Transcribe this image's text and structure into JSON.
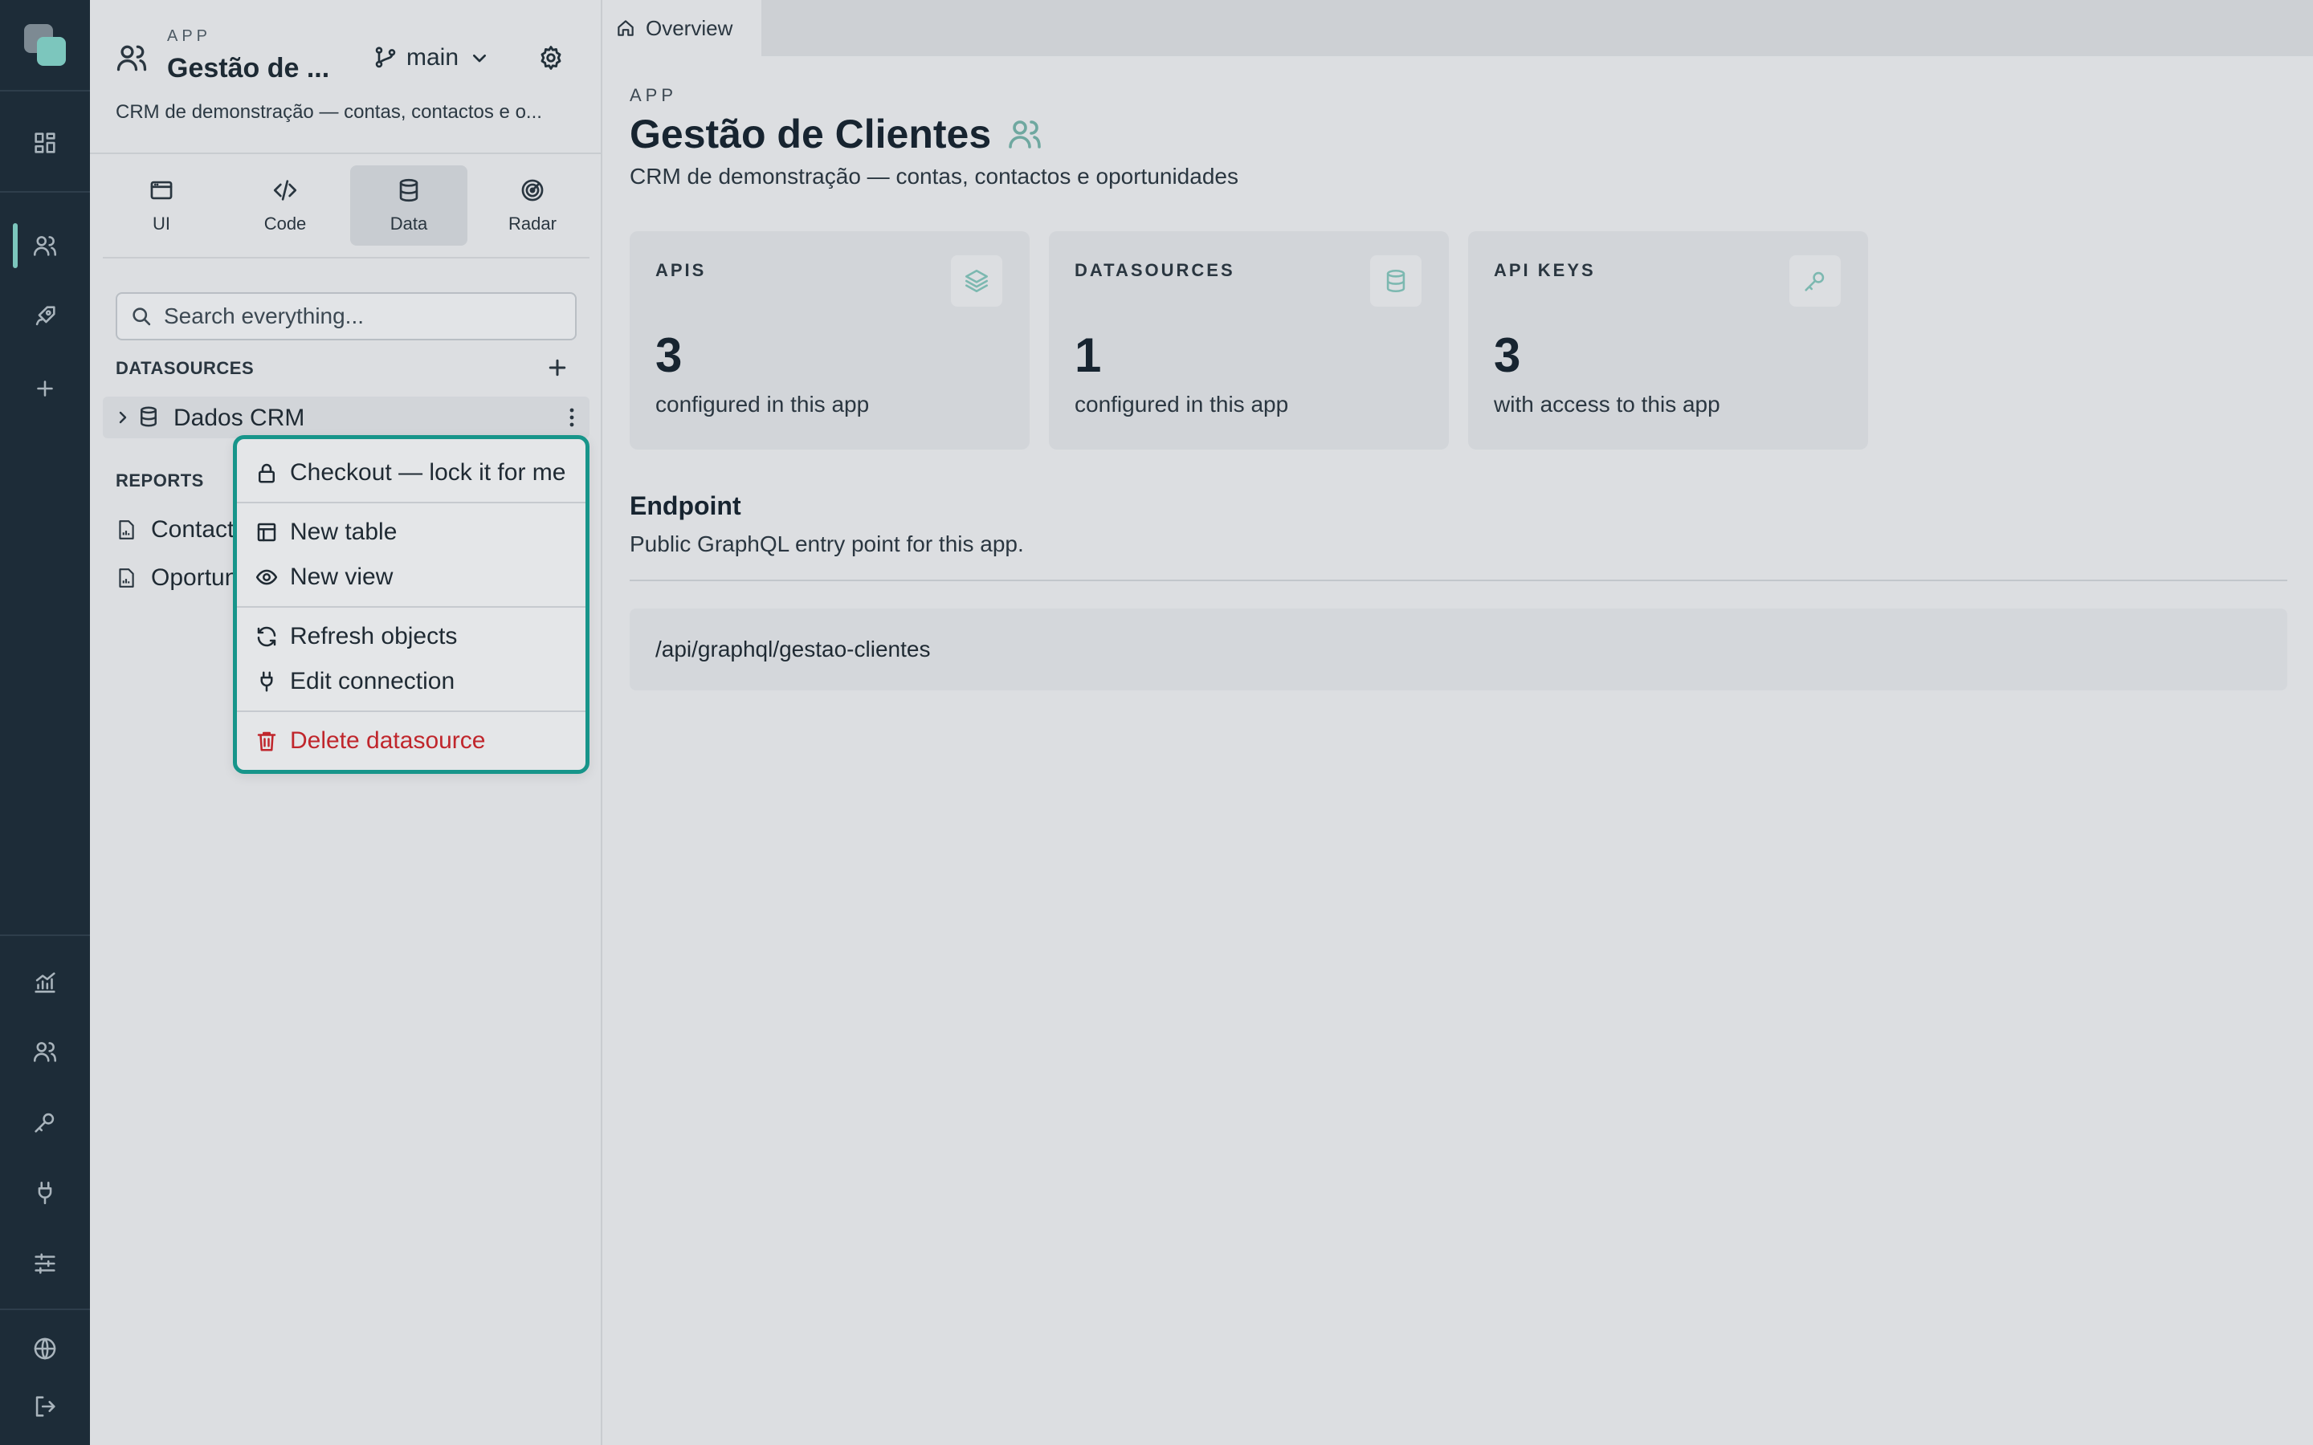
{
  "rail": {
    "icons": [
      "dashboard-icon",
      "users-icon",
      "rocket-icon",
      "plus-icon",
      "analytics-icon",
      "team-icon",
      "key-icon",
      "plug-icon",
      "sliders-icon",
      "globe-icon",
      "logout-icon"
    ],
    "accent": "#7cc6bd"
  },
  "panel": {
    "kicker": "APP",
    "app_name": "Gestão de ...",
    "branch": "main",
    "description": "CRM de demonstração — contas, contactos e o...",
    "tabs": [
      {
        "label": "UI"
      },
      {
        "label": "Code"
      },
      {
        "label": "Data"
      },
      {
        "label": "Radar"
      }
    ],
    "active_tab": "Data",
    "search_placeholder": "Search everything...",
    "datasources_title": "DATASOURCES",
    "datasource": {
      "label": "Dados CRM"
    },
    "reports_title": "REPORTS",
    "reports": [
      {
        "label": "Contactos"
      },
      {
        "label": "Oportunidades"
      }
    ]
  },
  "menu": {
    "items": [
      {
        "label": "Checkout — lock it for me",
        "icon": "lock-icon"
      },
      {
        "label": "New table",
        "icon": "table-icon"
      },
      {
        "label": "New view",
        "icon": "eye-icon"
      },
      {
        "label": "Refresh objects",
        "icon": "refresh-icon"
      },
      {
        "label": "Edit connection",
        "icon": "plug-icon"
      },
      {
        "label": "Delete datasource",
        "icon": "trash-icon"
      }
    ],
    "border_color": "#17958a",
    "danger_color": "#c0262c"
  },
  "main": {
    "tab_label": "Overview",
    "kicker": "APP",
    "title": "Gestão de Clientes",
    "subtitle": "CRM de demonstração — contas, contactos e oportunidades",
    "cards": [
      {
        "label": "APIS",
        "value": "3",
        "caption": "configured in this app",
        "icon": "layers-icon"
      },
      {
        "label": "DATASOURCES",
        "value": "1",
        "caption": "configured in this app",
        "icon": "database-icon"
      },
      {
        "label": "API KEYS",
        "value": "3",
        "caption": "with access to this app",
        "icon": "key-icon"
      }
    ],
    "endpoint_title": "Endpoint",
    "endpoint_subtitle": "Public GraphQL entry point for this app.",
    "endpoint_path": "/api/graphql/gestao-clientes"
  }
}
